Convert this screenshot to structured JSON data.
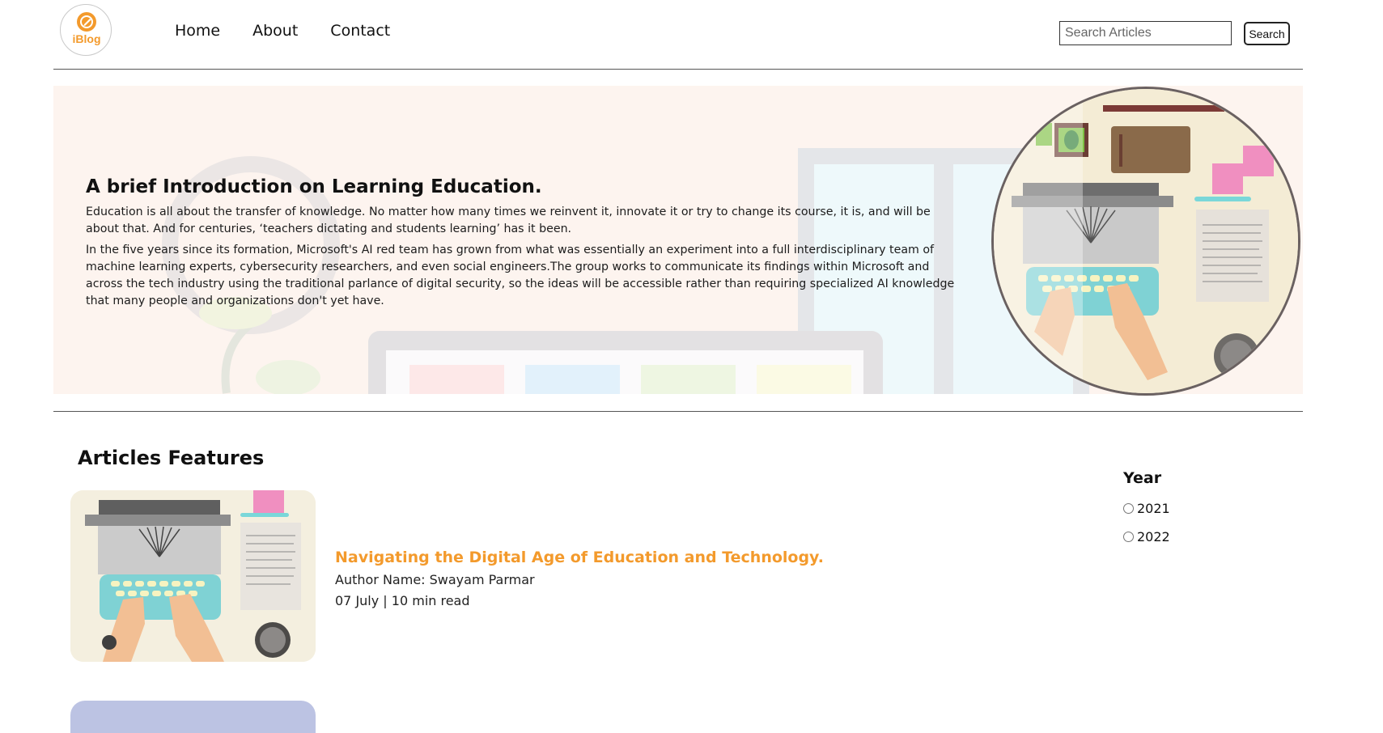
{
  "header": {
    "logo_text": "iBlog",
    "nav": [
      {
        "label": "Home"
      },
      {
        "label": "About"
      },
      {
        "label": "Contact"
      }
    ],
    "search_placeholder": "Search Articles",
    "search_button": "Search"
  },
  "hero": {
    "title": "A brief Introduction on Learning Education.",
    "paragraph1": "Education is all about the transfer of knowledge. No matter how many times we reinvent it, innovate it or try to change its course, it is, and will be about that. And for centuries, ‘teachers dictating and students learning’ has it been.",
    "paragraph2": "In the five years since its formation, Microsoft's AI red team has grown from what was essentially an experiment into a full interdisciplinary team of machine learning experts, cybersecurity researchers, and even social engineers.The group works to communicate its findings within Microsoft and across the tech industry using the traditional parlance of digital security, so the ideas will be accessible rather than requiring specialized AI knowledge that many people and organizations don't yet have."
  },
  "articles": {
    "section_title": "Articles Features",
    "items": [
      {
        "title": "Navigating the Digital Age of Education and Technology.",
        "author": "Author Name: Swayam Parmar",
        "meta": "07 July | 10 min read"
      }
    ]
  },
  "filter": {
    "title": "Year",
    "options": [
      {
        "label": "2021"
      },
      {
        "label": "2022"
      }
    ]
  },
  "colors": {
    "accent": "#f39a2c",
    "hero_bg": "#fdf4ef",
    "card2_bg": "#bcc3e3"
  }
}
